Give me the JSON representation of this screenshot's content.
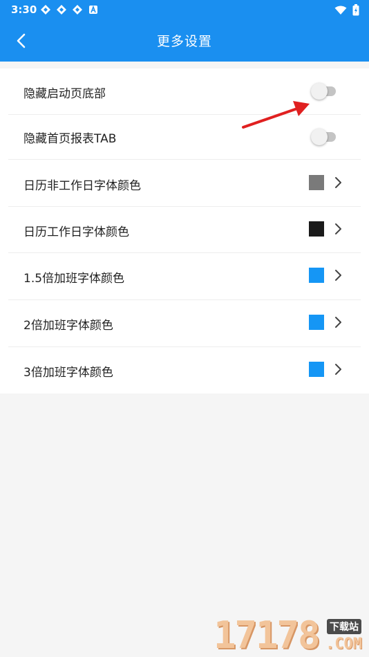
{
  "status_bar": {
    "time": "3:30",
    "notification_icons": [
      "app-notification-icon",
      "app-notification-icon",
      "app-notification-icon",
      "a-letter-notification-icon"
    ],
    "system_icons": [
      "wifi-icon",
      "battery-charging-icon"
    ]
  },
  "app_bar": {
    "title": "更多设置",
    "back_icon": "chevron-left-icon"
  },
  "settings": {
    "items": [
      {
        "label": "隐藏启动页底部",
        "control": "toggle",
        "checked": false
      },
      {
        "label": "隐藏首页报表TAB",
        "control": "toggle",
        "checked": false
      },
      {
        "label": "日历非工作日字体颜色",
        "control": "color",
        "color": "#7a7a7a"
      },
      {
        "label": "日历工作日字体颜色",
        "control": "color",
        "color": "#1a1a1a"
      },
      {
        "label": "1.5倍加班字体颜色",
        "control": "color",
        "color": "#1596f5"
      },
      {
        "label": "2倍加班字体颜色",
        "control": "color",
        "color": "#1596f5"
      },
      {
        "label": "3倍加班字体颜色",
        "control": "color",
        "color": "#1596f5"
      }
    ]
  },
  "watermark": {
    "digits": "17178",
    "badge": "下载站",
    "domain": ".COM"
  },
  "colors": {
    "accent": "#1a8ff0",
    "annotation_arrow": "#e02020"
  }
}
